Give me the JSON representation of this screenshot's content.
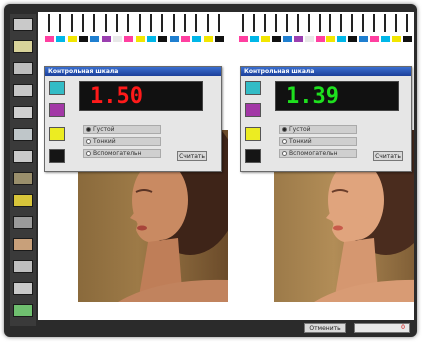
{
  "toolbar": {
    "tools": [
      {
        "name": "page-icon",
        "color": "#c9c9c9"
      },
      {
        "name": "image-icon",
        "color": "#d8d39a"
      },
      {
        "name": "grid-icon",
        "color": "#bdbdbd"
      },
      {
        "name": "layers-icon",
        "color": "#c7c7c7"
      },
      {
        "name": "print-icon",
        "color": "#cfcfcf"
      },
      {
        "name": "monitor-icon",
        "color": "#bfc6c9"
      },
      {
        "name": "palette-icon",
        "color": "#c9c9c9"
      },
      {
        "name": "levels-icon",
        "color": "#9a8f6c"
      },
      {
        "name": "yellow-icon",
        "color": "#d8c53a"
      },
      {
        "name": "brush-icon",
        "color": "#9a9a9a"
      },
      {
        "name": "flag-icon",
        "color": "#c8a07a"
      },
      {
        "name": "settings-icon",
        "color": "#bfbfbf"
      },
      {
        "name": "curve-icon",
        "color": "#c9c9c9"
      },
      {
        "name": "accept-icon",
        "color": "#6fbf6f"
      }
    ]
  },
  "scale": {
    "colors": [
      "#ff3fa0",
      "#00b7e8",
      "#f2e600",
      "#111111",
      "#1f7fd0",
      "#9b3fb0",
      "#e8e8e8",
      "#ff3fa0",
      "#f2e600",
      "#00b7e8",
      "#111111",
      "#1f7fd0"
    ]
  },
  "dialog_left": {
    "title": "Контрольная шкала",
    "value": "1.50",
    "value_color": "#ff1a1a",
    "options": [
      "Густой",
      "Тонкий",
      "Вспомогательн"
    ],
    "button": "Считать",
    "swatches": [
      "#33bcc6",
      "#a238a6",
      "#ecec22",
      "#151515"
    ]
  },
  "dialog_right": {
    "title": "Контрольная шкала",
    "value": "1.39",
    "value_color": "#1ee01e",
    "options": [
      "Густой",
      "Тонкий",
      "Вспомогательн"
    ],
    "button": "Считать",
    "swatches": [
      "#33bcc6",
      "#a238a6",
      "#ecec22",
      "#151515"
    ]
  },
  "status": {
    "button": "Отменить",
    "value": "0"
  }
}
